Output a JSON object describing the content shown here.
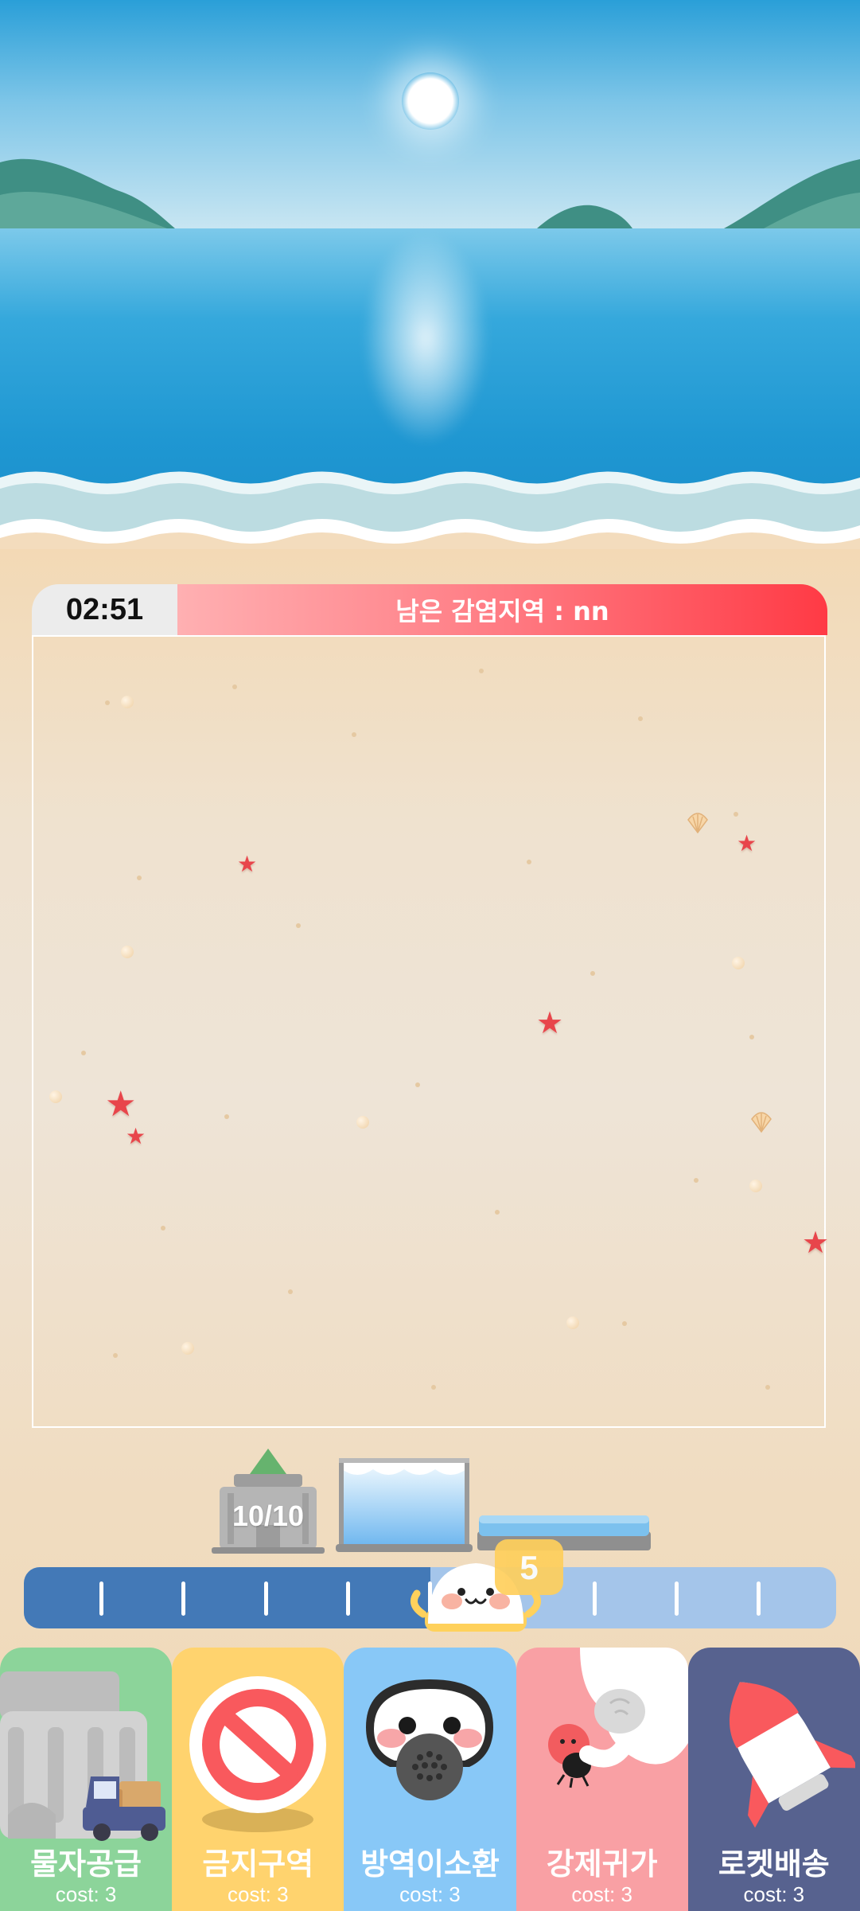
{
  "hud": {
    "timer": "02:51",
    "zones_remaining_label": "남은 감염지역 : nn"
  },
  "warehouse": {
    "capacity": "10/10"
  },
  "gauge": {
    "value": "5",
    "level_fraction": 0.5,
    "fill_color": "#4379b7",
    "empty_color": "#a4c5ea"
  },
  "cards": [
    {
      "label": "물자공급",
      "cost": "cost: 3",
      "color": "#8cd49a",
      "icon": "supply-truck-icon"
    },
    {
      "label": "금지구역",
      "cost": "cost: 3",
      "color": "#ffd36e",
      "icon": "prohibited-icon"
    },
    {
      "label": "방역이소환",
      "cost": "cost: 3",
      "color": "#88c8f7",
      "icon": "gas-mask-icon"
    },
    {
      "label": "강제귀가",
      "cost": "cost: 3",
      "color": "#f9a0a4",
      "icon": "grab-hand-icon"
    },
    {
      "label": "로켓배송",
      "cost": "cost: 3",
      "color": "#57628f",
      "icon": "rocket-icon"
    }
  ]
}
